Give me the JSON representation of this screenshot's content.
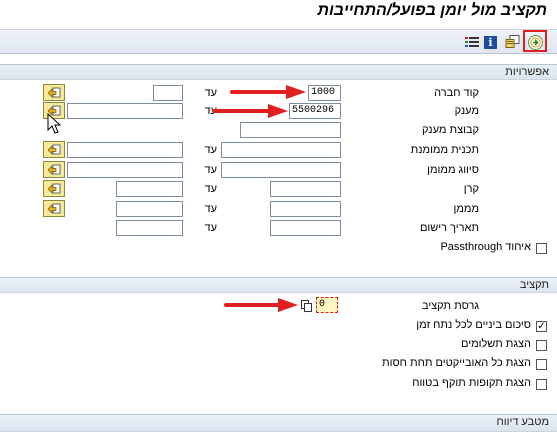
{
  "window": {
    "title": "תקציב מול יומן בפועל/התחייבות"
  },
  "toolbar": {
    "execute_icon": "execute-icon",
    "variant_icon": "get-variant-icon",
    "info_icon": "info-icon",
    "list_icon": "dynamic-selections-icon"
  },
  "options": {
    "header": "אפשרויות",
    "to_label": "עד",
    "rows": [
      {
        "label": "קוד חברה",
        "from_value": "1000",
        "to_value": ""
      },
      {
        "label": "מענק",
        "from_value": "5500296",
        "to_value": ""
      },
      {
        "label": "קבוצת מענק",
        "from_value": ""
      },
      {
        "label": "תכנית ממומנת",
        "from_value": "",
        "to_value": ""
      },
      {
        "label": "סיווג ממומן",
        "from_value": "",
        "to_value": ""
      },
      {
        "label": "קרן",
        "from_value": "",
        "to_value": ""
      },
      {
        "label": "מממן",
        "from_value": "",
        "to_value": ""
      },
      {
        "label": "תאריך רישום",
        "from_value": "",
        "to_value": ""
      }
    ],
    "passthrough_label": "איחוד Passthrough",
    "passthrough_checked": false
  },
  "budget": {
    "header": "תקציב",
    "version_label": "גרסת תקציב",
    "version_value": "0",
    "checkboxes": [
      {
        "label": "סיכום ביניים לכל נתח זמן",
        "checked": true
      },
      {
        "label": "הצגת תשלומים",
        "checked": false
      },
      {
        "label": "הצגת כל האובייקטים תחת חסות",
        "checked": false
      },
      {
        "label": "הצגת תקופות תוקף בטווח",
        "checked": false
      }
    ]
  },
  "report_format": {
    "header": "מטבע דיווח"
  },
  "colors": {
    "annotation_red": "#e02020",
    "section_bg": "#dbe4ee",
    "multisel_yellow": "#f5e99a"
  }
}
